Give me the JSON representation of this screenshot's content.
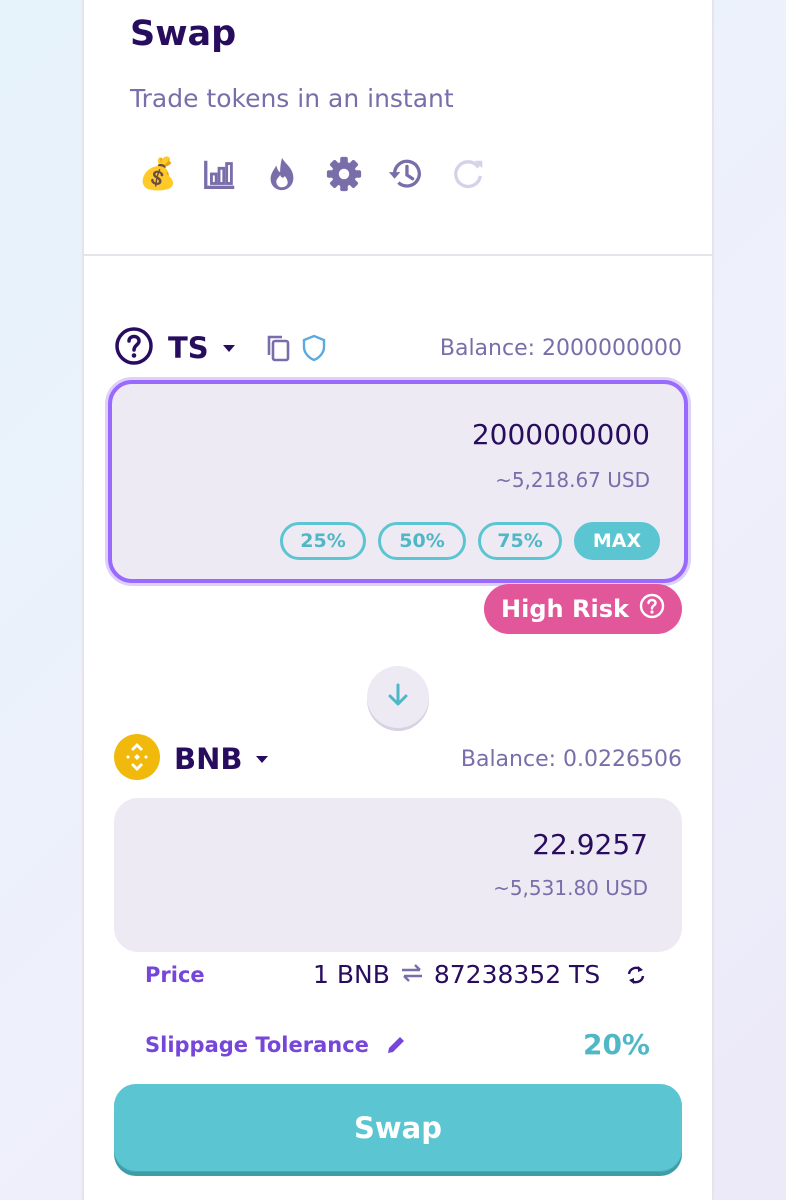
{
  "header": {
    "title": "Swap",
    "subtitle": "Trade tokens in an instant",
    "toolbar_icons": [
      "money-bag-icon",
      "chart-icon",
      "fire-icon",
      "gear-icon",
      "history-icon",
      "refresh-icon"
    ]
  },
  "from": {
    "symbol": "TS",
    "balance": "Balance: 2000000000",
    "amount": "2000000000",
    "usd": "~5,218.67 USD",
    "percent_buttons": [
      "25%",
      "50%",
      "75%",
      "MAX"
    ],
    "risk_label": "High Risk"
  },
  "to": {
    "symbol": "BNB",
    "balance": "Balance: 0.0226506",
    "amount": "22.9257",
    "usd": "~5,531.80 USD"
  },
  "price": {
    "label": "Price",
    "left": "1 BNB",
    "right": "87238352 TS"
  },
  "slippage": {
    "label": "Slippage Tolerance",
    "value": "20%"
  },
  "swap_button": "Swap",
  "colors": {
    "primary_text": "#280d5f",
    "secondary_text": "#7a6eaa",
    "accent_teal": "#5bc5d2",
    "accent_purple": "#7645d9",
    "risk_pink": "#e2569a",
    "bnb_yellow": "#f0b90b"
  }
}
